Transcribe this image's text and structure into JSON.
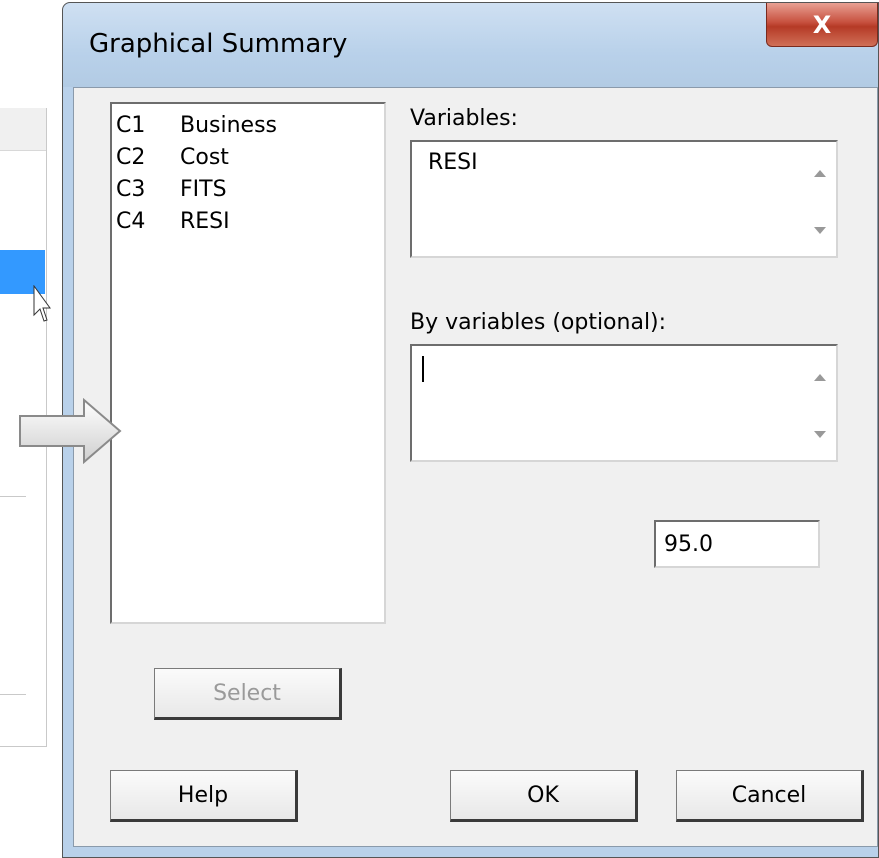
{
  "dialog": {
    "title": "Graphical Summary",
    "close_symbol": "X"
  },
  "variable_list": [
    {
      "id": "C1",
      "name": "Business"
    },
    {
      "id": "C2",
      "name": "Cost"
    },
    {
      "id": "C3",
      "name": "FITS"
    },
    {
      "id": "C4",
      "name": "RESI"
    }
  ],
  "variables": {
    "label": "Variables:",
    "value": "RESI"
  },
  "by_variables": {
    "label": "By variables (optional):",
    "value": ""
  },
  "confidence_field": {
    "value": "95.0"
  },
  "buttons": {
    "select": "Select",
    "help": "Help",
    "ok": "OK",
    "cancel": "Cancel"
  },
  "icons": {
    "close": "close-icon",
    "arrow": "right-arrow-icon",
    "cursor": "mouse-pointer-icon"
  },
  "colors": {
    "highlight": "#3399ff",
    "close_button": "#c7503e",
    "dialog_frame": "#b9d1ea"
  }
}
